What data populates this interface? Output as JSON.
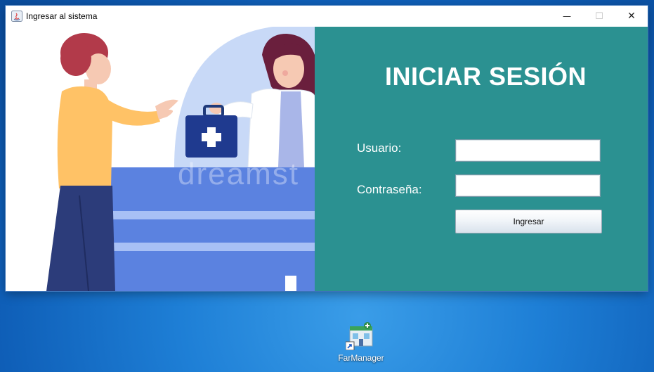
{
  "window": {
    "title": "Ingresar al sistema",
    "controls": {
      "minimize": "—",
      "maximize": "☐",
      "close": "✕"
    }
  },
  "illustration": {
    "watermark": "dreamst"
  },
  "login": {
    "heading": "INICIAR SESIÓN",
    "user_label": "Usuario:",
    "user_value": "",
    "password_label": "Contraseña:",
    "password_value": "",
    "submit_label": "Ingresar"
  },
  "desktop": {
    "shortcut_label": "FarManager"
  },
  "colors": {
    "panel": "#2b9191",
    "desktop": "#1e7fd6"
  }
}
